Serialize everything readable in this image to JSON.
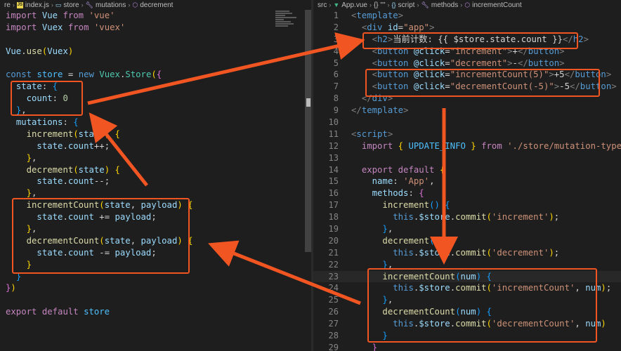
{
  "left": {
    "breadcrumb": [
      "re",
      "index.js",
      "store",
      "mutations",
      "decrement"
    ],
    "lines": [
      [
        [
          "kw",
          "import"
        ],
        [
          "p",
          " "
        ],
        [
          "var",
          "Vue"
        ],
        [
          "p",
          " "
        ],
        [
          "kw",
          "from"
        ],
        [
          "p",
          " "
        ],
        [
          "str",
          "'vue'"
        ]
      ],
      [
        [
          "kw",
          "import"
        ],
        [
          "p",
          " "
        ],
        [
          "var",
          "Vuex"
        ],
        [
          "p",
          " "
        ],
        [
          "kw",
          "from"
        ],
        [
          "p",
          " "
        ],
        [
          "str",
          "'vuex'"
        ]
      ],
      [],
      [
        [
          "var",
          "Vue"
        ],
        [
          "p",
          "."
        ],
        [
          "fn",
          "use"
        ],
        [
          "br1",
          "("
        ],
        [
          "var",
          "Vuex"
        ],
        [
          "br1",
          ")"
        ]
      ],
      [],
      [
        [
          "kw2",
          "const"
        ],
        [
          "p",
          " "
        ],
        [
          "const",
          "store"
        ],
        [
          "p",
          " = "
        ],
        [
          "kw2",
          "new"
        ],
        [
          "p",
          " "
        ],
        [
          "cls",
          "Vuex"
        ],
        [
          "p",
          "."
        ],
        [
          "cls",
          "Store"
        ],
        [
          "br1",
          "("
        ],
        [
          "br2",
          "{"
        ]
      ],
      [
        [
          "p",
          "  "
        ],
        [
          "var",
          "state"
        ],
        [
          "p",
          ": "
        ],
        [
          "br3",
          "{"
        ]
      ],
      [
        [
          "p",
          "    "
        ],
        [
          "var",
          "count"
        ],
        [
          "p",
          ": "
        ],
        [
          "num",
          "0"
        ]
      ],
      [
        [
          "p",
          "  "
        ],
        [
          "br3",
          "}"
        ],
        [
          "p",
          ","
        ]
      ],
      [
        [
          "p",
          "  "
        ],
        [
          "var",
          "mutations"
        ],
        [
          "p",
          ": "
        ],
        [
          "br3",
          "{"
        ]
      ],
      [
        [
          "p",
          "    "
        ],
        [
          "fn",
          "increment"
        ],
        [
          "br1",
          "("
        ],
        [
          "var",
          "state"
        ],
        [
          "br1",
          ")"
        ],
        [
          "p",
          " "
        ],
        [
          "br1",
          "{"
        ]
      ],
      [
        [
          "p",
          "      "
        ],
        [
          "var",
          "state"
        ],
        [
          "p",
          "."
        ],
        [
          "var",
          "count"
        ],
        [
          "p",
          "++;"
        ]
      ],
      [
        [
          "p",
          "    "
        ],
        [
          "br1",
          "}"
        ],
        [
          "p",
          ","
        ]
      ],
      [
        [
          "p",
          "    "
        ],
        [
          "fn",
          "decrement"
        ],
        [
          "br1",
          "("
        ],
        [
          "var",
          "state"
        ],
        [
          "br1",
          ")"
        ],
        [
          "p",
          " "
        ],
        [
          "br1",
          "{"
        ]
      ],
      [
        [
          "p",
          "      "
        ],
        [
          "var",
          "state"
        ],
        [
          "p",
          "."
        ],
        [
          "var",
          "count"
        ],
        [
          "p",
          "--;"
        ]
      ],
      [
        [
          "p",
          "    "
        ],
        [
          "br1",
          "}"
        ],
        [
          "p",
          ","
        ]
      ],
      [
        [
          "p",
          "    "
        ],
        [
          "fn",
          "incrementCount"
        ],
        [
          "br1",
          "("
        ],
        [
          "var",
          "state"
        ],
        [
          "p",
          ", "
        ],
        [
          "var",
          "payload"
        ],
        [
          "br1",
          ")"
        ],
        [
          "p",
          " "
        ],
        [
          "br1",
          "{"
        ]
      ],
      [
        [
          "p",
          "      "
        ],
        [
          "var",
          "state"
        ],
        [
          "p",
          "."
        ],
        [
          "var",
          "count"
        ],
        [
          "p",
          " += "
        ],
        [
          "var",
          "payload"
        ],
        [
          "p",
          ";"
        ]
      ],
      [
        [
          "p",
          "    "
        ],
        [
          "br1",
          "}"
        ],
        [
          "p",
          ","
        ]
      ],
      [
        [
          "p",
          "    "
        ],
        [
          "fn",
          "decrementCount"
        ],
        [
          "br1",
          "("
        ],
        [
          "var",
          "state"
        ],
        [
          "p",
          ", "
        ],
        [
          "var",
          "payload"
        ],
        [
          "br1",
          ")"
        ],
        [
          "p",
          " "
        ],
        [
          "br1",
          "{"
        ]
      ],
      [
        [
          "p",
          "      "
        ],
        [
          "var",
          "state"
        ],
        [
          "p",
          "."
        ],
        [
          "var",
          "count"
        ],
        [
          "p",
          " -= "
        ],
        [
          "var",
          "payload"
        ],
        [
          "p",
          ";"
        ]
      ],
      [
        [
          "p",
          "    "
        ],
        [
          "br1",
          "}"
        ]
      ],
      [
        [
          "p",
          "  "
        ],
        [
          "br3",
          "}"
        ]
      ],
      [
        [
          "br2",
          "}"
        ],
        [
          "br1",
          ")"
        ]
      ],
      [],
      [
        [
          "kw",
          "export"
        ],
        [
          "p",
          " "
        ],
        [
          "kw",
          "default"
        ],
        [
          "p",
          " "
        ],
        [
          "const",
          "store"
        ]
      ]
    ]
  },
  "right": {
    "breadcrumb": [
      "src",
      "App.vue",
      "{} \"\"",
      "script",
      "methods",
      "incrementCount"
    ],
    "start_line": 1,
    "lines": [
      [
        [
          "ptag",
          "<"
        ],
        [
          "tag",
          "template"
        ],
        [
          "ptag",
          ">"
        ]
      ],
      [
        [
          "p",
          "  "
        ],
        [
          "ptag",
          "<"
        ],
        [
          "tag",
          "div"
        ],
        [
          "p",
          " "
        ],
        [
          "attr",
          "id"
        ],
        [
          "p",
          "="
        ],
        [
          "str",
          "\"app\""
        ],
        [
          "ptag",
          ">"
        ]
      ],
      [
        [
          "p",
          "    "
        ],
        [
          "ptag",
          "<"
        ],
        [
          "tag",
          "h2"
        ],
        [
          "ptag",
          ">"
        ],
        [
          "p",
          "当前计数: {{ $store.state.count }}"
        ],
        [
          "ptag",
          "</"
        ],
        [
          "tag",
          "h2"
        ],
        [
          "ptag",
          ">"
        ]
      ],
      [
        [
          "p",
          "    "
        ],
        [
          "ptag",
          "<"
        ],
        [
          "tag",
          "button"
        ],
        [
          "p",
          " "
        ],
        [
          "attr",
          "@click"
        ],
        [
          "p",
          "="
        ],
        [
          "str",
          "\"increment\""
        ],
        [
          "ptag",
          ">"
        ],
        [
          "p",
          "+"
        ],
        [
          "ptag",
          "</"
        ],
        [
          "tag",
          "button"
        ],
        [
          "ptag",
          ">"
        ]
      ],
      [
        [
          "p",
          "    "
        ],
        [
          "ptag",
          "<"
        ],
        [
          "tag",
          "button"
        ],
        [
          "p",
          " "
        ],
        [
          "attr",
          "@click"
        ],
        [
          "p",
          "="
        ],
        [
          "str",
          "\"decrement\""
        ],
        [
          "ptag",
          ">"
        ],
        [
          "p",
          "-"
        ],
        [
          "ptag",
          "</"
        ],
        [
          "tag",
          "button"
        ],
        [
          "ptag",
          ">"
        ]
      ],
      [
        [
          "p",
          "    "
        ],
        [
          "ptag",
          "<"
        ],
        [
          "tag",
          "button"
        ],
        [
          "p",
          " "
        ],
        [
          "attr",
          "@click"
        ],
        [
          "p",
          "="
        ],
        [
          "str",
          "\"incrementCount(5)\""
        ],
        [
          "ptag",
          ">"
        ],
        [
          "p",
          "+5"
        ],
        [
          "ptag",
          "</"
        ],
        [
          "tag",
          "button"
        ],
        [
          "ptag",
          ">"
        ]
      ],
      [
        [
          "p",
          "    "
        ],
        [
          "ptag",
          "<"
        ],
        [
          "tag",
          "button"
        ],
        [
          "p",
          " "
        ],
        [
          "attr",
          "@click"
        ],
        [
          "p",
          "="
        ],
        [
          "str",
          "\"decrementCount(-5)\""
        ],
        [
          "ptag",
          ">"
        ],
        [
          "p",
          "-5"
        ],
        [
          "ptag",
          "</"
        ],
        [
          "tag",
          "button"
        ],
        [
          "ptag",
          ">"
        ]
      ],
      [
        [
          "p",
          "  "
        ],
        [
          "ptag",
          "</"
        ],
        [
          "tag",
          "div"
        ],
        [
          "ptag",
          ">"
        ]
      ],
      [
        [
          "ptag",
          "</"
        ],
        [
          "tag",
          "template"
        ],
        [
          "ptag",
          ">"
        ]
      ],
      [],
      [
        [
          "ptag",
          "<"
        ],
        [
          "tag",
          "script"
        ],
        [
          "ptag",
          ">"
        ]
      ],
      [
        [
          "p",
          "  "
        ],
        [
          "kw",
          "import"
        ],
        [
          "p",
          " "
        ],
        [
          "br1",
          "{"
        ],
        [
          "p",
          " "
        ],
        [
          "const",
          "UPDATE_INFO"
        ],
        [
          "p",
          " "
        ],
        [
          "br1",
          "}"
        ],
        [
          "p",
          " "
        ],
        [
          "kw",
          "from"
        ],
        [
          "p",
          " "
        ],
        [
          "str",
          "'./store/mutation-types'"
        ]
      ],
      [],
      [
        [
          "p",
          "  "
        ],
        [
          "kw",
          "export"
        ],
        [
          "p",
          " "
        ],
        [
          "kw",
          "default"
        ],
        [
          "p",
          " "
        ],
        [
          "br1",
          "{"
        ]
      ],
      [
        [
          "p",
          "    "
        ],
        [
          "var",
          "name"
        ],
        [
          "p",
          ": "
        ],
        [
          "str",
          "'App'"
        ],
        [
          "p",
          ","
        ]
      ],
      [
        [
          "p",
          "    "
        ],
        [
          "var",
          "methods"
        ],
        [
          "p",
          ": "
        ],
        [
          "br2",
          "{"
        ]
      ],
      [
        [
          "p",
          "      "
        ],
        [
          "fn",
          "increment"
        ],
        [
          "br3",
          "()"
        ],
        [
          "p",
          " "
        ],
        [
          "br3",
          "{"
        ]
      ],
      [
        [
          "p",
          "        "
        ],
        [
          "kw2",
          "this"
        ],
        [
          "p",
          "."
        ],
        [
          "var",
          "$store"
        ],
        [
          "p",
          "."
        ],
        [
          "fn",
          "commit"
        ],
        [
          "br1",
          "("
        ],
        [
          "str",
          "'increment'"
        ],
        [
          "br1",
          ")"
        ],
        [
          "p",
          ";"
        ]
      ],
      [
        [
          "p",
          "      "
        ],
        [
          "br3",
          "}"
        ],
        [
          "p",
          ","
        ]
      ],
      [
        [
          "p",
          "      "
        ],
        [
          "fn",
          "decrement"
        ],
        [
          "br3",
          "()"
        ],
        [
          "p",
          " "
        ],
        [
          "br3",
          "{"
        ]
      ],
      [
        [
          "p",
          "        "
        ],
        [
          "kw2",
          "this"
        ],
        [
          "p",
          "."
        ],
        [
          "var",
          "$store"
        ],
        [
          "p",
          "."
        ],
        [
          "fn",
          "commit"
        ],
        [
          "br1",
          "("
        ],
        [
          "str",
          "'decrement'"
        ],
        [
          "br1",
          ")"
        ],
        [
          "p",
          ";"
        ]
      ],
      [
        [
          "p",
          "      "
        ],
        [
          "br3",
          "}"
        ],
        [
          "p",
          ","
        ]
      ],
      [
        [
          "p",
          "      "
        ],
        [
          "fn",
          "incrementCount"
        ],
        [
          "br3",
          "("
        ],
        [
          "var",
          "num"
        ],
        [
          "br3",
          ")"
        ],
        [
          "p",
          " "
        ],
        [
          "br3",
          "{"
        ]
      ],
      [
        [
          "p",
          "        "
        ],
        [
          "kw2",
          "this"
        ],
        [
          "p",
          "."
        ],
        [
          "var",
          "$store"
        ],
        [
          "p",
          "."
        ],
        [
          "fn",
          "commit"
        ],
        [
          "br1",
          "("
        ],
        [
          "str",
          "'incrementCount'"
        ],
        [
          "p",
          ", "
        ],
        [
          "var",
          "num"
        ],
        [
          "br1",
          ")"
        ],
        [
          "p",
          ";"
        ]
      ],
      [
        [
          "p",
          "      "
        ],
        [
          "br3",
          "}"
        ],
        [
          "p",
          ","
        ]
      ],
      [
        [
          "p",
          "      "
        ],
        [
          "fn",
          "decrementCount"
        ],
        [
          "br3",
          "("
        ],
        [
          "var",
          "num"
        ],
        [
          "br3",
          ")"
        ],
        [
          "p",
          " "
        ],
        [
          "br3",
          "{"
        ]
      ],
      [
        [
          "p",
          "        "
        ],
        [
          "kw2",
          "this"
        ],
        [
          "p",
          "."
        ],
        [
          "var",
          "$store"
        ],
        [
          "p",
          "."
        ],
        [
          "fn",
          "commit"
        ],
        [
          "br1",
          "("
        ],
        [
          "str",
          "'decrementCount'"
        ],
        [
          "p",
          ", "
        ],
        [
          "var",
          "num"
        ],
        [
          "br1",
          ")"
        ]
      ],
      [
        [
          "p",
          "      "
        ],
        [
          "br3",
          "}"
        ]
      ],
      [
        [
          "p",
          "    "
        ],
        [
          "br2",
          "}"
        ]
      ]
    ]
  },
  "colors": {
    "editor_background": "#1e1e1e",
    "annotation_red": "#f05522"
  }
}
